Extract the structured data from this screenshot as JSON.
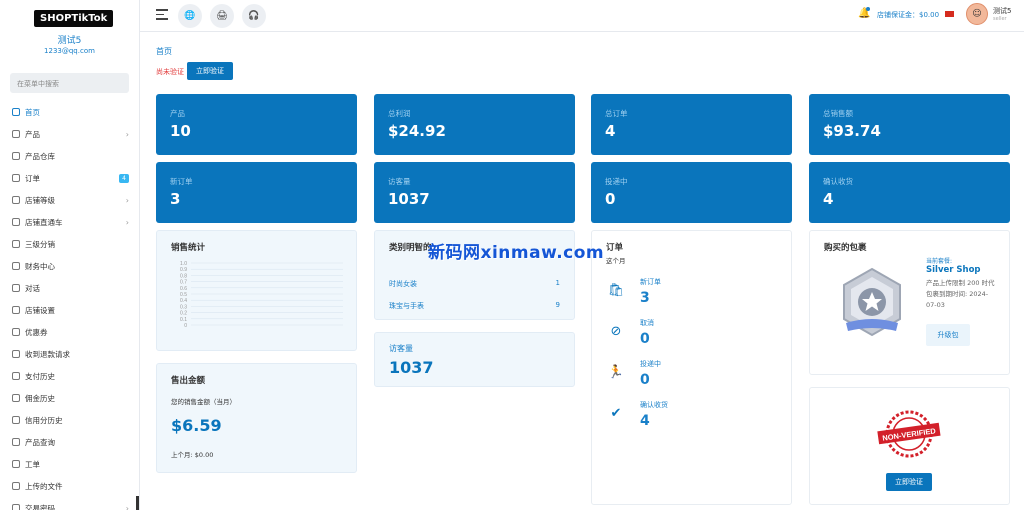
{
  "sidebar": {
    "logo_text": "SHOPTikTok",
    "profile": {
      "name": "测试5",
      "email": "1233@qq.com"
    },
    "search_placeholder": "在菜单中搜索",
    "items": [
      {
        "label": "首页",
        "icon": "home-icon",
        "active": true
      },
      {
        "label": "产品",
        "icon": "cart-icon",
        "chevron": true
      },
      {
        "label": "产品仓库",
        "icon": "warehouse-icon"
      },
      {
        "label": "订单",
        "icon": "order-icon",
        "badge": "4"
      },
      {
        "label": "店铺等级",
        "icon": "level-icon",
        "chevron": true
      },
      {
        "label": "店铺直通车",
        "icon": "car-icon",
        "chevron": true
      },
      {
        "label": "三级分销",
        "icon": "network-icon"
      },
      {
        "label": "财务中心",
        "icon": "finance-icon"
      },
      {
        "label": "对话",
        "icon": "chat-icon"
      },
      {
        "label": "店铺设置",
        "icon": "settings-icon"
      },
      {
        "label": "优惠券",
        "icon": "coupon-icon"
      },
      {
        "label": "收到退款请求",
        "icon": "refund-icon"
      },
      {
        "label": "支付历史",
        "icon": "payment-icon"
      },
      {
        "label": "佣金历史",
        "icon": "commission-icon"
      },
      {
        "label": "信用分历史",
        "icon": "credit-icon"
      },
      {
        "label": "产品查询",
        "icon": "query-icon"
      },
      {
        "label": "工单",
        "icon": "ticket-icon"
      },
      {
        "label": "上传的文件",
        "icon": "file-icon"
      },
      {
        "label": "交易密码",
        "icon": "lock-icon",
        "chevron": true
      }
    ]
  },
  "topbar": {
    "deposit_label": "店铺保证金：$0.00",
    "user_name": "测试5",
    "user_role": "seller"
  },
  "main": {
    "breadcrumb": "首页",
    "unverified_label": "尚未验证",
    "verify_button": "立即验证",
    "stats": [
      {
        "label": "产品",
        "value": "10"
      },
      {
        "label": "总利润",
        "value": "$24.92"
      },
      {
        "label": "总订单",
        "value": "4"
      },
      {
        "label": "总销售额",
        "value": "$93.74"
      },
      {
        "label": "新订单",
        "value": "3"
      },
      {
        "label": "访客量",
        "value": "1037"
      },
      {
        "label": "投递中",
        "value": "0"
      },
      {
        "label": "确认收货",
        "value": "4"
      }
    ],
    "sales_stats": {
      "title": "销售统计",
      "ticks": [
        "1.0",
        "0.9",
        "0.8",
        "0.7",
        "0.6",
        "0.5",
        "0.4",
        "0.3",
        "0.2",
        "0.1",
        "0"
      ]
    },
    "sales_amount": {
      "title": "售出金额",
      "subtitle": "您的销售金额（当月）",
      "value": "$6.59",
      "last_month": "上个月: $0.00"
    },
    "category": {
      "title": "类别明智的",
      "rows": [
        {
          "name": "时尚女装",
          "count": "1"
        },
        {
          "name": "珠宝与手表",
          "count": "9"
        }
      ]
    },
    "visitors": {
      "label": "访客量",
      "value": "1037"
    },
    "orders": {
      "title": "订单",
      "subtitle": "这个月",
      "rows": [
        {
          "label": "新订单",
          "value": "3",
          "icon": "new-order-icon"
        },
        {
          "label": "取消",
          "value": "0",
          "icon": "cancel-icon"
        },
        {
          "label": "投递中",
          "value": "0",
          "icon": "delivery-icon"
        },
        {
          "label": "确认收货",
          "value": "4",
          "icon": "received-icon"
        }
      ]
    },
    "package": {
      "title": "购买的包裹",
      "current_label": "当前套餐:",
      "name": "Silver Shop",
      "desc": "产品上传限制 200 时代包裹到期时间: 2024-07-03",
      "upgrade_button": "升级包"
    },
    "verification": {
      "stamp_text": "NON-VERIFIED",
      "button": "立即验证"
    }
  },
  "watermark": "新码网xinmaw.com",
  "colors": {
    "primary": "#0a75bc",
    "accent": "#1a80c9",
    "danger": "#e23b3b"
  }
}
